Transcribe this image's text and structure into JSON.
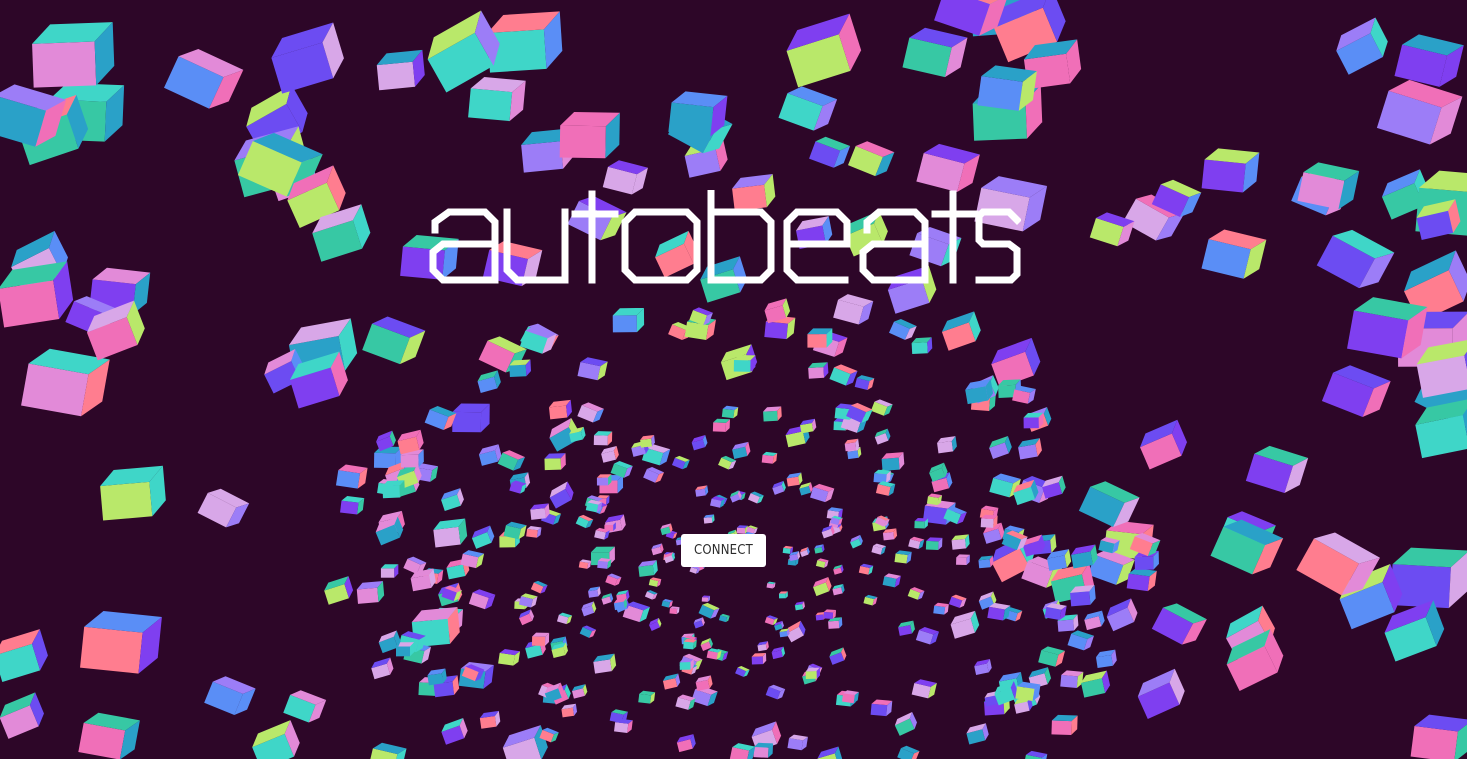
{
  "app": {
    "title": "autobeats",
    "background_color": "#2d0628"
  },
  "hero": {
    "title_text": "autobeats",
    "title_color": "#ffffff"
  },
  "actions": {
    "connect_label": "CONNECT"
  },
  "palette": {
    "cube_face_colors": [
      "#7f3ff0",
      "#5a8ef6",
      "#f06fb8",
      "#3fd6c8",
      "#b9e86a",
      "#e28ad8",
      "#2aa1c8",
      "#9c7df7",
      "#ff7d8f",
      "#37c8a4",
      "#6c4cf2",
      "#d8a7e8"
    ]
  }
}
